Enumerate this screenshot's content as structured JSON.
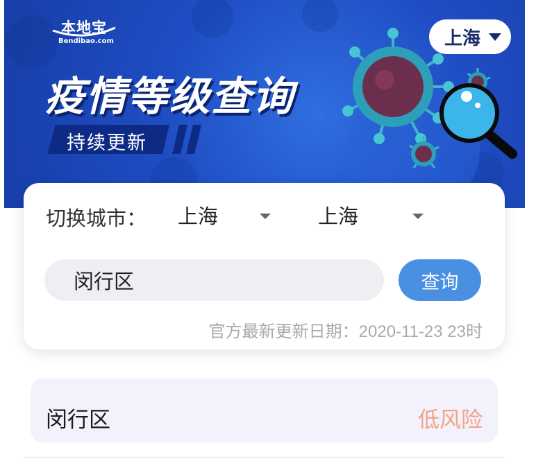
{
  "banner": {
    "logo_main": "本地宝",
    "logo_sub": "Bendibao.com",
    "headline": "疫情等级查询",
    "tag": "持续更新",
    "city_selector": "上海"
  },
  "search": {
    "switch_label": "切换城市：",
    "province_value": "上海",
    "city_value": "上海",
    "district_value": "闵行区",
    "query_label": "查询",
    "update_date": "官方最新更新日期：2020-11-23 23时"
  },
  "result": {
    "district": "闵行区",
    "risk": "低风险"
  },
  "colors": {
    "banner_blue": "#1f4dc4",
    "button_blue": "#4a90e2",
    "low_risk": "#f2a288",
    "result_bg": "#f3f1fb"
  },
  "icons": [
    "virus-icon",
    "magnifier-icon",
    "caret-down-icon"
  ]
}
